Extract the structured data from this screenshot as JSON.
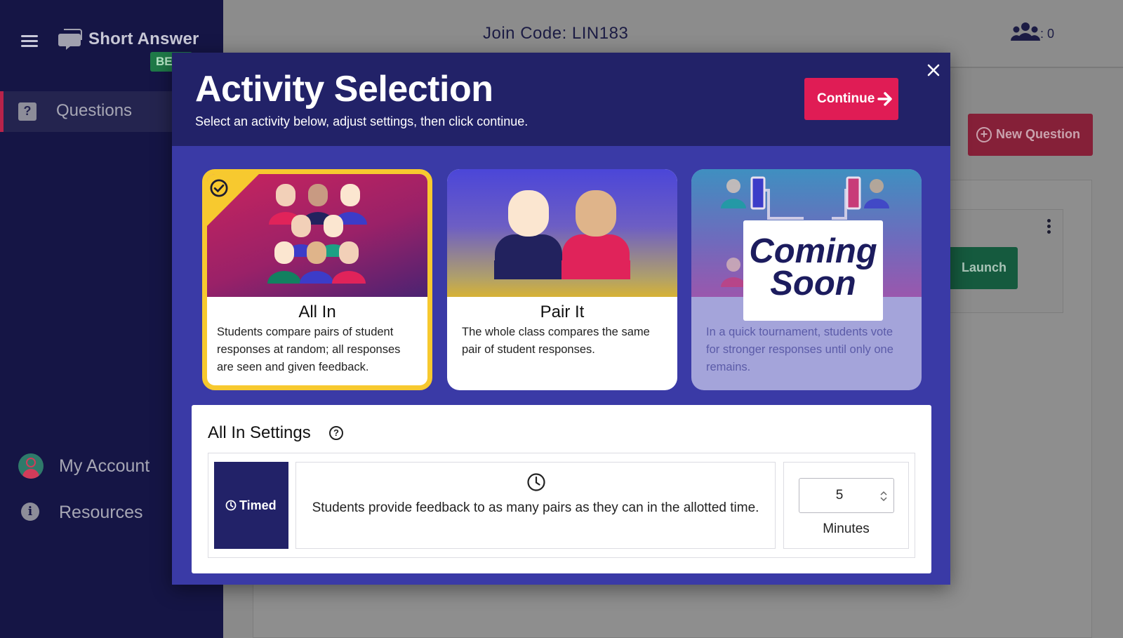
{
  "app": {
    "name": "Short Answer",
    "badge": "BETA"
  },
  "sidebar": {
    "items": [
      {
        "label": "Questions",
        "icon": "question-chat-icon"
      },
      {
        "label": "My Account",
        "icon": "avatar"
      },
      {
        "label": "Resources",
        "icon": "info-icon"
      }
    ]
  },
  "header": {
    "join_code": "Join Code: LIN183",
    "participants": ": 0"
  },
  "background": {
    "new_question_label": "New Question",
    "launch_label": "Launch"
  },
  "modal": {
    "title": "Activity Selection",
    "subtitle": "Select an activity below, adjust settings, then click continue.",
    "continue_label": "Continue",
    "close_icon": "close-icon",
    "activities": [
      {
        "title": "All In",
        "description": "Students compare pairs of student responses at random; all responses are seen and given feedback.",
        "selected": true
      },
      {
        "title": "Pair It",
        "description": "The whole class compares the same pair of student responses.",
        "selected": false
      },
      {
        "title": "",
        "description": "In a quick tournament, students vote for stronger responses until only one remains.",
        "overlay": "Coming Soon",
        "selected": false
      }
    ],
    "settings": {
      "title": "All In Settings",
      "mode_label": "Timed",
      "mode_description": "Students provide feedback to as many pairs as they can in the allotted time.",
      "minutes_value": "5",
      "minutes_label": "Minutes"
    }
  },
  "colors": {
    "sidebar_bg": "#151545",
    "modal_bg": "#3a3aa6",
    "modal_header_bg": "#222268",
    "accent": "#e01c55",
    "selected_border": "#f7c92f"
  }
}
